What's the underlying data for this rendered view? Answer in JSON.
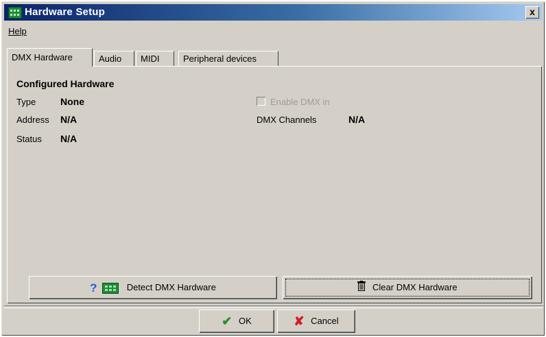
{
  "window": {
    "title": "Hardware Setup",
    "close_glyph": "x"
  },
  "menu": {
    "help": "Help"
  },
  "tabs": [
    {
      "label": "DMX Hardware",
      "active": true
    },
    {
      "label": "Audio",
      "active": false
    },
    {
      "label": "MIDI",
      "active": false
    },
    {
      "label": "Peripheral devices",
      "active": false
    }
  ],
  "configured": {
    "heading": "Configured Hardware",
    "type_label": "Type",
    "type_value": "None",
    "address_label": "Address",
    "address_value": "N/A",
    "status_label": "Status",
    "status_value": "N/A",
    "enable_dmx_in_label": "Enable DMX in",
    "enable_dmx_in_checked": false,
    "dmx_channels_label": "DMX Channels",
    "dmx_channels_value": "N/A"
  },
  "actions": {
    "detect_label": "Detect DMX Hardware",
    "clear_label": "Clear DMX Hardware"
  },
  "footer": {
    "ok_label": "OK",
    "cancel_label": "Cancel"
  },
  "icons": {
    "app": "green-hardware-board-icon",
    "detect": [
      "question-icon",
      "hardware-board-icon"
    ],
    "clear": "trash-icon",
    "ok": "checkmark-icon",
    "cancel": "red-x-icon"
  }
}
